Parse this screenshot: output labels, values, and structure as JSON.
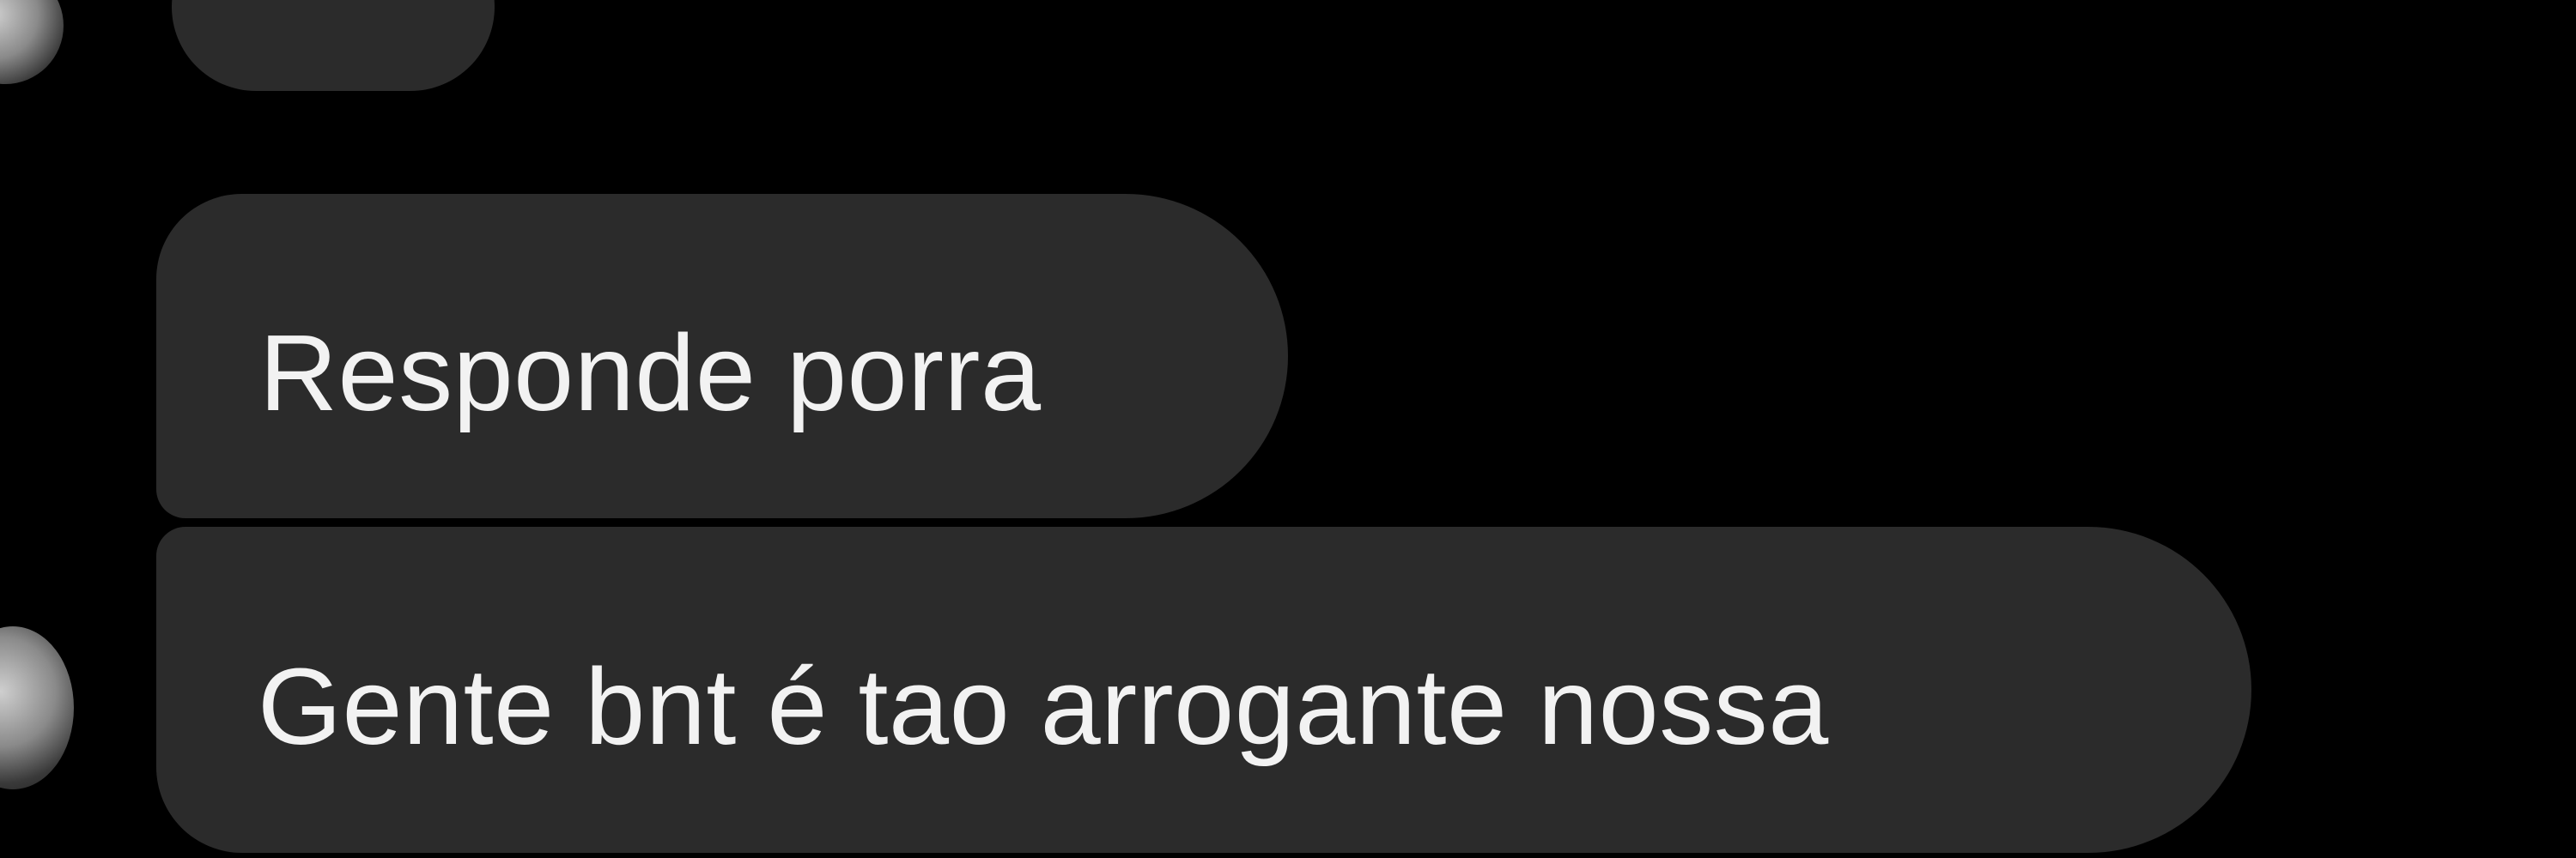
{
  "theme": {
    "background": "#000000",
    "bubble_color": "#2b2b2b",
    "text_color": "#ffffff"
  },
  "conversation": {
    "messages": [
      {
        "text": ""
      },
      {
        "text": "Responde porra"
      },
      {
        "text": "Gente bnt é tao arrogante nossa"
      }
    ]
  },
  "icons": {
    "sender_avatar": "avatar-icon"
  }
}
